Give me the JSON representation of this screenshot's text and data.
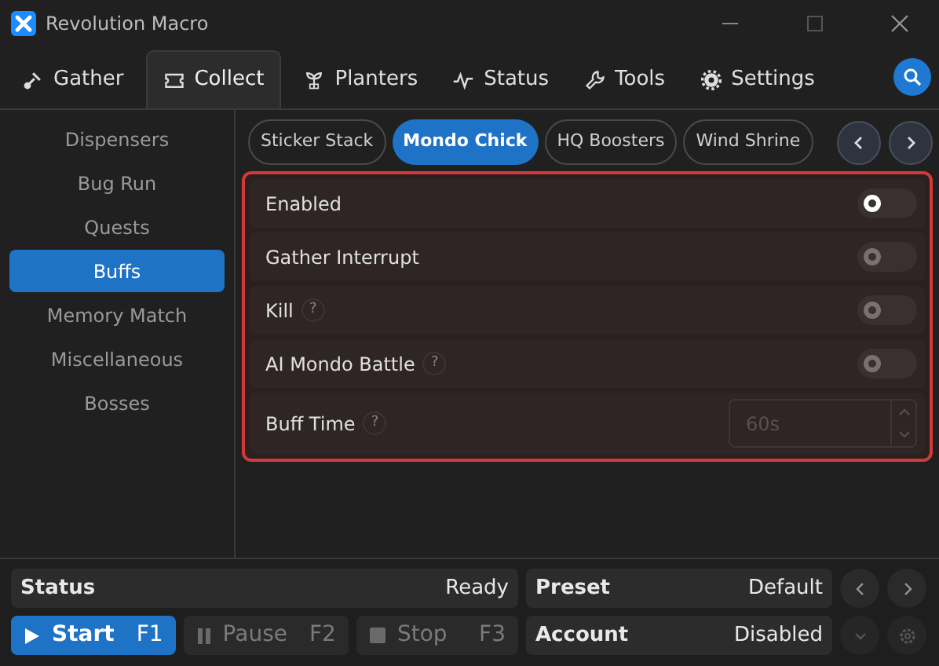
{
  "window": {
    "title": "Revolution Macro"
  },
  "tabs": [
    {
      "label": "Gather",
      "selected": false
    },
    {
      "label": "Collect",
      "selected": true
    },
    {
      "label": "Planters",
      "selected": false
    },
    {
      "label": "Status",
      "selected": false
    },
    {
      "label": "Tools",
      "selected": false
    },
    {
      "label": "Settings",
      "selected": false
    }
  ],
  "sidebar": {
    "items": [
      {
        "label": "Dispensers",
        "selected": false
      },
      {
        "label": "Bug Run",
        "selected": false
      },
      {
        "label": "Quests",
        "selected": false
      },
      {
        "label": "Buffs",
        "selected": true
      },
      {
        "label": "Memory Match",
        "selected": false
      },
      {
        "label": "Miscellaneous",
        "selected": false
      },
      {
        "label": "Bosses",
        "selected": false
      }
    ]
  },
  "subtabs": [
    {
      "label": "Sticker Stack",
      "selected": false
    },
    {
      "label": "Mondo Chick",
      "selected": true
    },
    {
      "label": "HQ Boosters",
      "selected": false
    },
    {
      "label": "Wind Shrine",
      "selected": false
    }
  ],
  "settings": [
    {
      "kind": "toggle",
      "label": "Enabled",
      "on": false,
      "disabled": false
    },
    {
      "kind": "toggle",
      "label": "Gather Interrupt",
      "on": false,
      "disabled": true
    },
    {
      "kind": "toggle",
      "label": "Kill",
      "help_mark": "?",
      "on": false,
      "disabled": true
    },
    {
      "kind": "toggle",
      "label": "AI Mondo Battle",
      "help_mark": "?",
      "on": false,
      "disabled": true
    },
    {
      "kind": "number",
      "label": "Buff Time",
      "help_mark": "?",
      "placeholder": "60s",
      "disabled": true
    }
  ],
  "status_bar": {
    "status_label": "Status",
    "status_value": "Ready",
    "preset_label": "Preset",
    "preset_value": "Default",
    "account_label": "Account",
    "account_value": "Disabled",
    "controls": [
      {
        "label": "Start",
        "key": "F1",
        "primary": true
      },
      {
        "label": "Pause",
        "key": "F2",
        "primary": false
      },
      {
        "label": "Stop",
        "key": "F3",
        "primary": false
      }
    ]
  }
}
